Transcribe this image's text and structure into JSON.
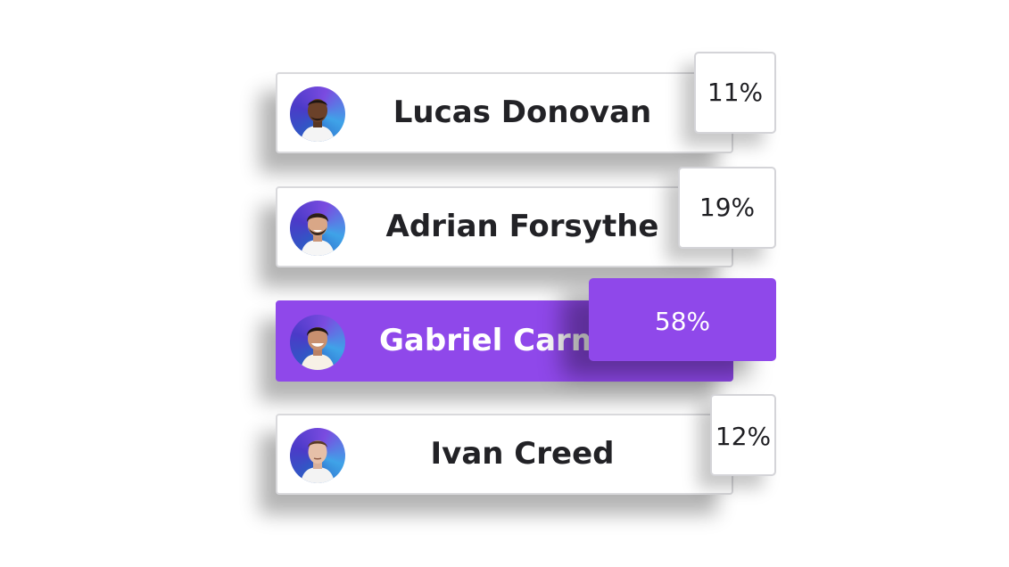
{
  "accent_color": "#8f48ea",
  "candidates": [
    {
      "name": "Lucas Donovan",
      "percent": "11%",
      "avatar_icon": "avatar-photo",
      "selected": false
    },
    {
      "name": "Adrian Forsythe",
      "percent": "19%",
      "avatar_icon": "avatar-photo",
      "selected": false
    },
    {
      "name": "Gabriel Carmi",
      "percent": "58%",
      "avatar_icon": "avatar-photo",
      "selected": true
    },
    {
      "name": "Ivan Creed",
      "percent": "12%",
      "avatar_icon": "avatar-photo",
      "selected": false
    }
  ]
}
